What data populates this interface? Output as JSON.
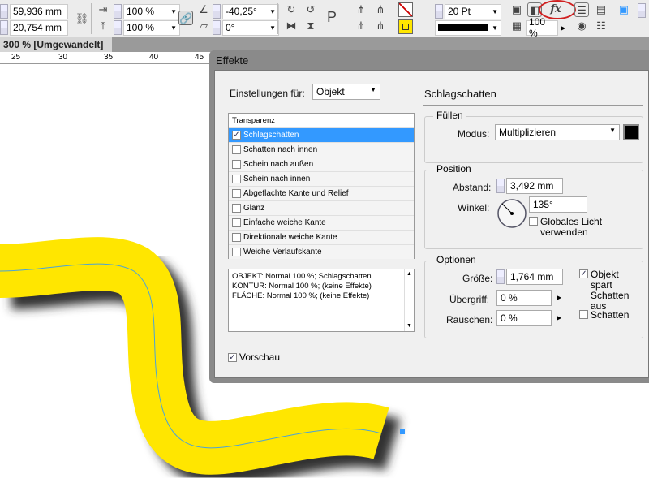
{
  "toolbar": {
    "b_value": "59,936 mm",
    "h_value": "20,754 mm",
    "scale_x": "100 %",
    "scale_y": "100 %",
    "rotate": "-40,25°",
    "shear": "0°",
    "stroke_weight": "20 Pt",
    "opacity": "100 %",
    "fx_label": "fx"
  },
  "document_tab": {
    "title": "300 % [Umgewandelt]",
    "close": "×"
  },
  "ruler": [
    "25",
    "30",
    "35",
    "40",
    "45"
  ],
  "dialog": {
    "title": "Effekte",
    "settings_label": "Einstellungen für:",
    "settings_value": "Objekt",
    "section_title": "Schlagschatten",
    "list_header": "Transparenz",
    "effects": [
      {
        "label": "Schlagschatten",
        "checked": true
      },
      {
        "label": "Schatten nach innen",
        "checked": false
      },
      {
        "label": "Schein nach außen",
        "checked": false
      },
      {
        "label": "Schein nach innen",
        "checked": false
      },
      {
        "label": "Abgeflachte Kante und Relief",
        "checked": false
      },
      {
        "label": "Glanz",
        "checked": false
      },
      {
        "label": "Einfache weiche Kante",
        "checked": false
      },
      {
        "label": "Direktionale weiche Kante",
        "checked": false
      },
      {
        "label": "Weiche Verlaufskante",
        "checked": false
      }
    ],
    "summary": [
      "OBJEKT: Normal 100 %; Schlagschatten",
      "KONTUR: Normal 100 %; (keine Effekte)",
      "FLÄCHE: Normal 100 %; (keine Effekte)"
    ],
    "preview_label": "Vorschau",
    "fill": {
      "title": "Füllen",
      "mode_label": "Modus:",
      "mode_value": "Multiplizieren",
      "color": "#000000"
    },
    "position": {
      "title": "Position",
      "distance_label": "Abstand:",
      "distance_value": "3,492 mm",
      "angle_label": "Winkel:",
      "angle_value": "135°",
      "global_light_label": "Globales Licht verwenden"
    },
    "options": {
      "title": "Optionen",
      "size_label": "Größe:",
      "size_value": "1,764 mm",
      "spread_label": "Übergriff:",
      "spread_value": "0 %",
      "noise_label": "Rauschen:",
      "noise_value": "0 %",
      "knockout_label": "Objekt spart Schatten aus",
      "shadow_label": "Schatten"
    }
  },
  "colors": {
    "accent": "#3399ff",
    "path": "#ffe600",
    "highlight": "#d02020"
  }
}
